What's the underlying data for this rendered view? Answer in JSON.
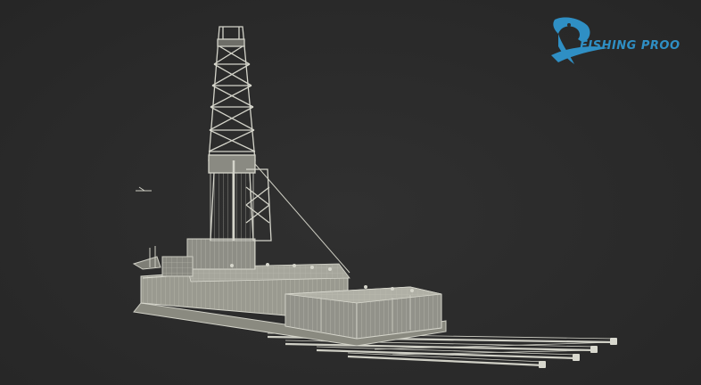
{
  "logo": {
    "text": "FISHING PROO",
    "color": "#2f8fc4",
    "icon": "fish-emblem-icon"
  },
  "scene": {
    "subject": "oil-drilling-rig-wireframe",
    "background_color": "#2b2b2b",
    "wire_color": "#cfcfc4"
  }
}
